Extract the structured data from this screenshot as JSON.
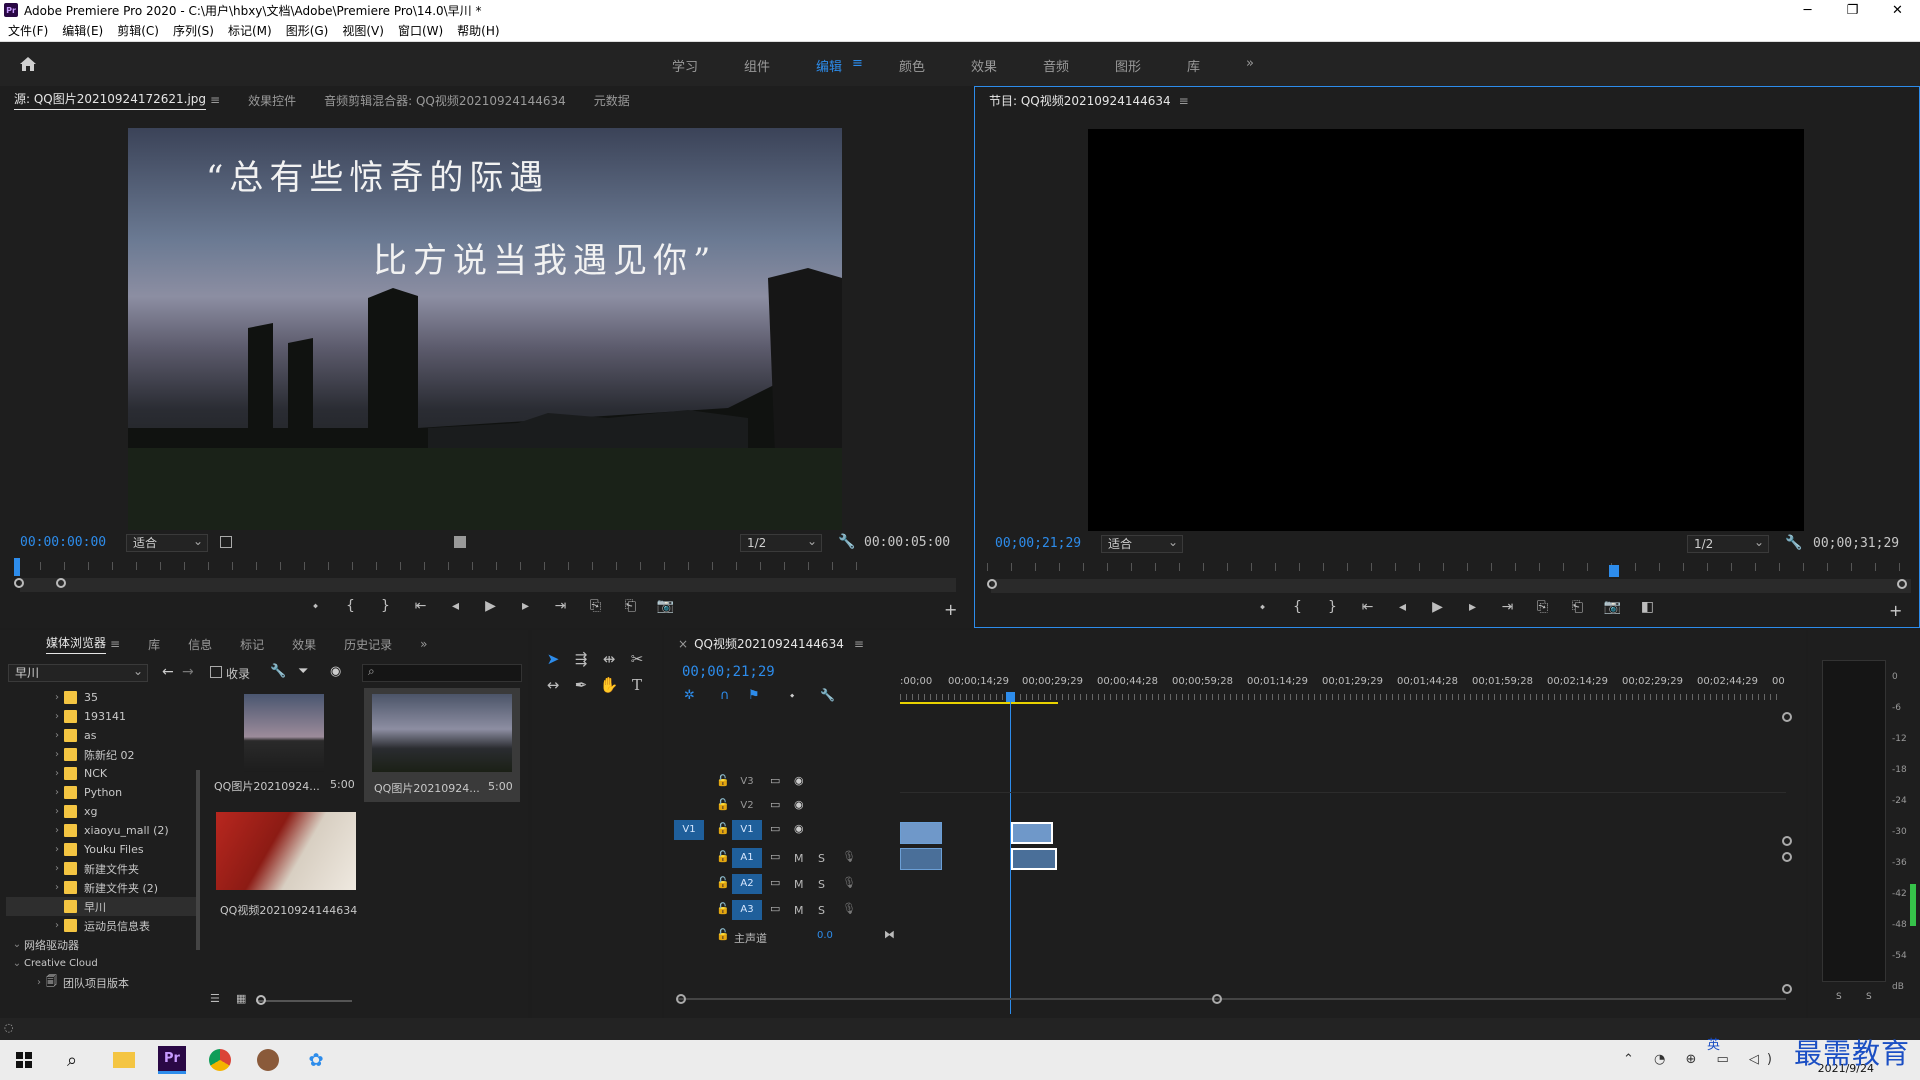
{
  "app": {
    "title": "Adobe Premiere Pro 2020 - C:\\用户\\hbxy\\文档\\Adobe\\Premiere Pro\\14.0\\早川 *",
    "logo_text": "Pr",
    "window_controls": [
      "─",
      "❐",
      "✕"
    ]
  },
  "menu": [
    "文件(F)",
    "编辑(E)",
    "剪辑(C)",
    "序列(S)",
    "标记(M)",
    "图形(G)",
    "视图(V)",
    "窗口(W)",
    "帮助(H)"
  ],
  "workspace": {
    "tabs": [
      "学习",
      "组件",
      "编辑",
      "颜色",
      "效果",
      "音频",
      "图形",
      "库"
    ],
    "active": "编辑",
    "more": "»"
  },
  "source": {
    "tabs": [
      "源: QQ图片20210924172621.jpg",
      "效果控件",
      "音频剪辑混合器: QQ视频20210924144634",
      "元数据"
    ],
    "overlay_line1": "“总有些惊奇的际遇",
    "overlay_line2": "比方说当我遇见你”",
    "timecode_in": "00:00:00:00",
    "fit": "适合",
    "resolution": "1/2",
    "duration": "00:00:05:00"
  },
  "program": {
    "tab": "节目: QQ视频20210924144634",
    "timecode": "00;00;21;29",
    "fit": "适合",
    "resolution": "1/2",
    "duration": "00;00;31;29"
  },
  "project": {
    "tabs": [
      "媒体浏览器",
      "库",
      "信息",
      "标记",
      "效果",
      "历史记录"
    ],
    "location": "早川",
    "ingest_label": "收录",
    "folders": [
      "35",
      "193141",
      "as",
      "陈新纪 02",
      "NCK",
      "Python",
      "xg",
      "xiaoyu_mall (2)",
      "Youku Files",
      "新建文件夹",
      "新建文件夹 (2)",
      "早川",
      "运动员信息表"
    ],
    "network_label": "网络驱动器",
    "cc_label": "Creative Cloud",
    "team_label": "团队项目版本",
    "items": [
      {
        "name": "QQ图片20210924...",
        "duration": "5:00"
      },
      {
        "name": "QQ图片20210924...",
        "duration": "5:00"
      },
      {
        "name": "QQ视频20210924144634",
        "duration": ""
      }
    ]
  },
  "timeline": {
    "tab": "QQ视频20210924144634",
    "timecode": "00;00;21;29",
    "ruler": [
      ":00;00",
      "00;00;14;29",
      "00;00;29;29",
      "00;00;44;28",
      "00;00;59;28",
      "00;01;14;29",
      "00;01;29;29",
      "00;01;44;28",
      "00;01;59;28",
      "00;02;14;29",
      "00;02;29;29",
      "00;02;44;29",
      "00"
    ],
    "video_tracks": [
      "V3",
      "V2",
      "V1"
    ],
    "audio_tracks": [
      "A1",
      "A2",
      "A3"
    ],
    "source_patch": "V1",
    "master_label": "主声道",
    "master_value": "0.0",
    "mute": "M",
    "solo": "S"
  },
  "meter": {
    "scale": [
      "0",
      "-6",
      "-12",
      "-18",
      "-24",
      "-30",
      "-36",
      "-42",
      "-48",
      "-54",
      "dB"
    ],
    "solo_buttons": [
      "S",
      "S"
    ]
  },
  "taskbar": {
    "date": "2021/9/24",
    "ime": "英",
    "watermark": "最需教育"
  },
  "colors": {
    "accent": "#2d8ceb",
    "clip_video": "#6f98c9",
    "track_on": "#1f5f9b",
    "folder": "#f4c542"
  }
}
